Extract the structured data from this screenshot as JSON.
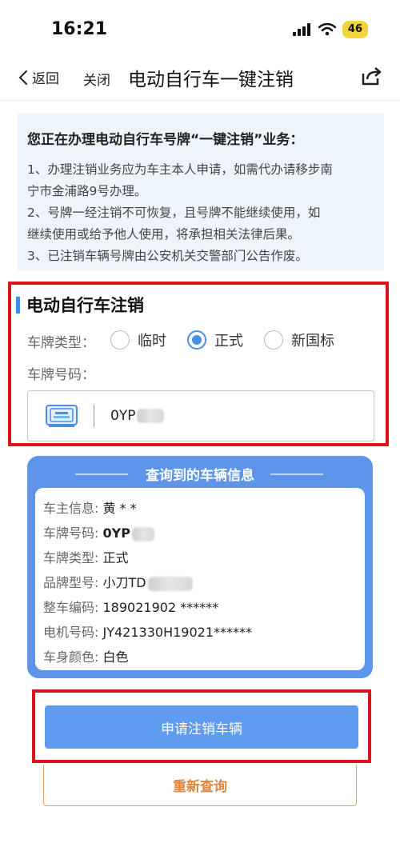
{
  "status_bar": {
    "time": "16:21",
    "battery": "46",
    "icons": [
      "signal-icon",
      "wifi-icon",
      "battery-icon"
    ]
  },
  "nav": {
    "back_label": "返回",
    "close_label": "关闭",
    "title": "电动自行车一键注销",
    "share_icon": "share-icon"
  },
  "notice": {
    "title": "您正在办理电动自行车号牌“一键注销”业务：",
    "lines": [
      "1、办理注销业务应为车主本人申请，如需代办请移步南",
      "宁市金浦路9号办理。",
      "2、号牌一经注销不可恢复，且号牌不能继续使用，如",
      "继续使用或给予他人使用，将承担相关法律后果。",
      "3、已注销车辆号牌由公安机关交警部门公告作废。"
    ]
  },
  "form": {
    "section_title": "电动自行车注销",
    "plate_type_label": "车牌类型：",
    "plate_type_options": [
      "临时",
      "正式",
      "新国标"
    ],
    "plate_type_selected": "正式",
    "plate_number_label": "车牌号码：",
    "plate_number_value": "0YP",
    "accent_color": "#3b8ef0"
  },
  "vehicle_info": {
    "header": "查询到的车辆信息",
    "rows": [
      {
        "key": "车主信息:",
        "value": "黄 * *"
      },
      {
        "key": "车牌号码:",
        "value": "0YP"
      },
      {
        "key": "车牌类型:",
        "value": "正式"
      },
      {
        "key": "品牌型号:",
        "value": "小刀TD"
      },
      {
        "key": "整车编码:",
        "value": "189021902 ******"
      },
      {
        "key": "电机号码:",
        "value": "JY421330H19021******"
      },
      {
        "key": "车身颜色:",
        "value": "白色"
      }
    ],
    "card_color": "#5c95ea"
  },
  "actions": {
    "apply_label": "申请注销车辆",
    "requery_label": "重新查询",
    "apply_color": "#5f9bef",
    "requery_color": "#e0843c"
  }
}
